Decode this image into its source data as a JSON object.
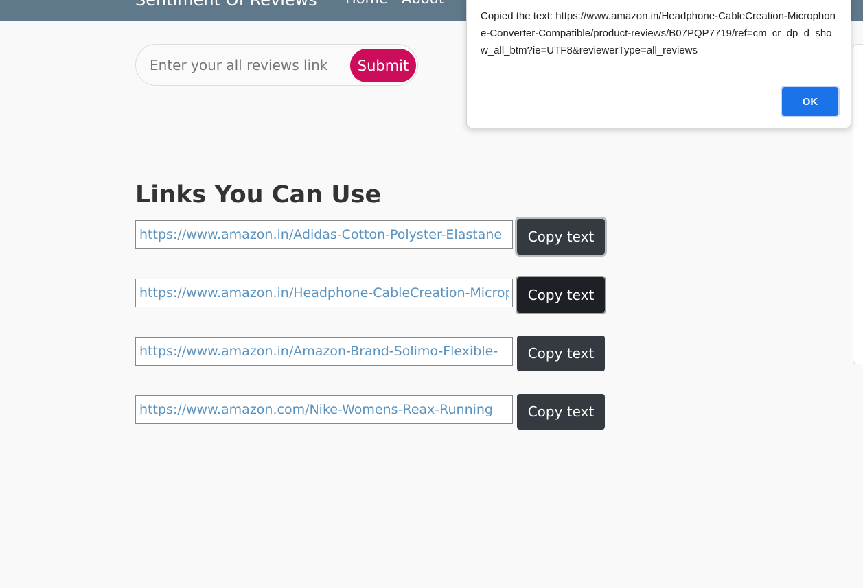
{
  "navbar": {
    "brand": "Sentiment Of Reviews",
    "links": [
      "Home",
      "About"
    ]
  },
  "search": {
    "placeholder": "Enter your all reviews link",
    "value": "",
    "submit_label": "Submit"
  },
  "section_title": "Links You Can Use",
  "links": [
    {
      "url": "https://www.amazon.in/Adidas-Cotton-Polyster-Elastane",
      "button": "Copy text"
    },
    {
      "url": "https://www.amazon.in/Headphone-CableCreation-Microphone",
      "button": "Copy text"
    },
    {
      "url": "https://www.amazon.in/Amazon-Brand-Solimo-Flexible-",
      "button": "Copy text"
    },
    {
      "url": "https://www.amazon.com/Nike-Womens-Reax-Running",
      "button": "Copy text"
    }
  ],
  "dialog": {
    "message": "Copied the text: https://www.amazon.in/Headphone-CableCreation-Microphone-Converter-Compatible/product-reviews/B07PQP7719/ref=cm_cr_dp_d_show_all_btm?ie=UTF8&reviewerType=all_reviews",
    "ok_label": "OK"
  },
  "colors": {
    "navbar": "#5f788a",
    "submit": "#cc0d5a",
    "copy_button": "#343a40",
    "link_text": "#5a93c0",
    "ok_button": "#1a73e8"
  }
}
